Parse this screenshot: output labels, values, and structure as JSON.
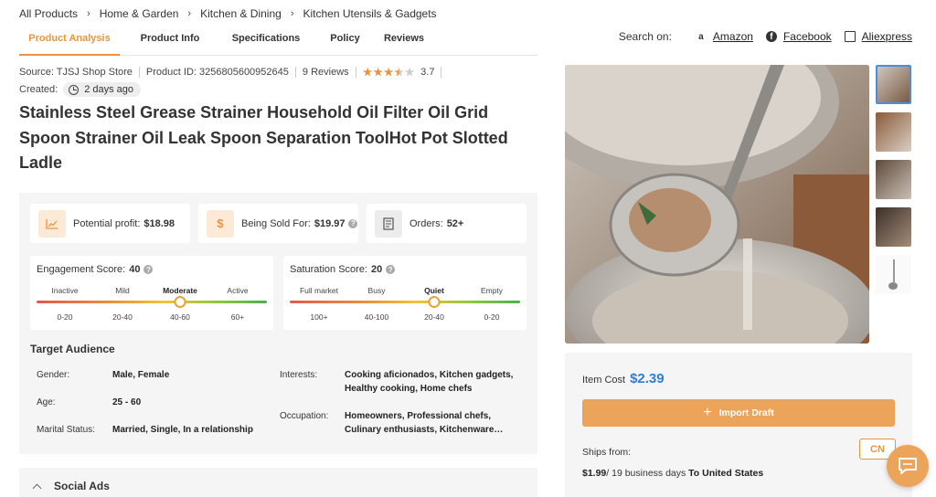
{
  "breadcrumb": [
    "All Products",
    "Home & Garden",
    "Kitchen & Dining",
    "Kitchen Utensils & Gadgets"
  ],
  "tabs": [
    {
      "label": "Product Analysis",
      "active": true
    },
    {
      "label": "Product Info",
      "active": false
    },
    {
      "label": "Specifications",
      "active": false
    },
    {
      "label": "Policy",
      "active": false
    },
    {
      "label": "Reviews",
      "active": false
    }
  ],
  "search_on": {
    "label": "Search on:",
    "sites": [
      {
        "name": "Amazon",
        "icon": "amazon-icon"
      },
      {
        "name": "Facebook",
        "icon": "facebook-icon"
      },
      {
        "name": "Aliexpress",
        "icon": "mail-icon"
      }
    ]
  },
  "meta": {
    "source": "Source: TJSJ Shop Store",
    "product_id": "Product ID: 3256805600952645",
    "reviews": "9 Reviews",
    "rating": 3.7,
    "rating_text": "3.7",
    "created_label": "Created:",
    "created_value": "2 days ago"
  },
  "title": "Stainless Steel Grease Strainer Household Oil Filter Oil Grid Spoon Strainer Oil Leak Spoon Separation ToolHot Pot Slotted Ladle",
  "cards": {
    "profit_label": "Potential profit:",
    "profit_value": "$18.98",
    "sold_label": "Being Sold For:",
    "sold_value": "$19.97",
    "orders_label": "Orders:",
    "orders_value": "52+"
  },
  "engagement": {
    "label": "Engagement Score:",
    "value": "40",
    "levels": [
      "Inactive",
      "Mild",
      "Moderate",
      "Active"
    ],
    "ranges": [
      "0-20",
      "20-40",
      "40-60",
      "60+"
    ],
    "selected_index": 2
  },
  "saturation": {
    "label": "Saturation Score:",
    "value": "20",
    "levels": [
      "Full market",
      "Busy",
      "Quiet",
      "Empty"
    ],
    "ranges": [
      "100+",
      "40-100",
      "20-40",
      "0-20"
    ],
    "selected_index": 2
  },
  "audience": {
    "title": "Target Audience",
    "gender_label": "Gender:",
    "gender_value": "Male, Female",
    "age_label": "Age:",
    "age_value": "25 - 60",
    "marital_label": "Marital Status:",
    "marital_value": "Married, Single, In a relationship",
    "interests_label": "Interests:",
    "interests_line1": "Cooking aficionados, Kitchen gadgets,",
    "interests_line2": "Healthy cooking, Home chefs",
    "occupation_label": "Occupation:",
    "occupation_line1": "Homeowners, Professional chefs,",
    "occupation_line2": "Culinary enthusiasts, Kitchenware…"
  },
  "social_ads": "Social Ads",
  "pricing": {
    "item_cost_label": "Item Cost",
    "item_cost_value": "$2.39",
    "import_label": "Import Draft",
    "ships_from_label": "Ships from:",
    "country_button": "CN",
    "ship_price": "$1.99",
    "ship_days": "/ 19 business days",
    "ship_dest": "To United States"
  },
  "colors": {
    "accent": "#e8953c",
    "price": "#2f7ed8",
    "button": "#eca45b"
  }
}
